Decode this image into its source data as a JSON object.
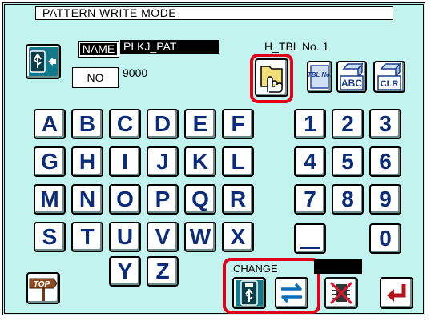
{
  "header": {
    "mode_title": "PATTERN WRITE MODE"
  },
  "fields": {
    "name_label": "NAME",
    "name_value": "PLKJ_PAT",
    "no_label": "NO",
    "no_value": "9000",
    "table_label": "H_TBL No.  1"
  },
  "toolbar": {
    "tbl_no_text": "TBL No.",
    "abc_text": "ABC",
    "clr_text": "CLR"
  },
  "keys": {
    "letters": [
      "A",
      "B",
      "C",
      "D",
      "E",
      "F",
      "G",
      "H",
      "I",
      "J",
      "K",
      "L",
      "M",
      "N",
      "O",
      "P",
      "Q",
      "R",
      "S",
      "T",
      "U",
      "V",
      "W",
      "X",
      "Y",
      "Z"
    ],
    "digits": [
      "1",
      "2",
      "3",
      "4",
      "5",
      "6",
      "7",
      "8",
      "9",
      "0"
    ]
  },
  "bottom": {
    "top_label": "TOP",
    "change_label": "CHANGE"
  },
  "colors": {
    "background": "#c2f3ee",
    "key_text": "#0a2c7a",
    "highlight": "#e3001b",
    "enter_arrow": "#b0161c"
  }
}
